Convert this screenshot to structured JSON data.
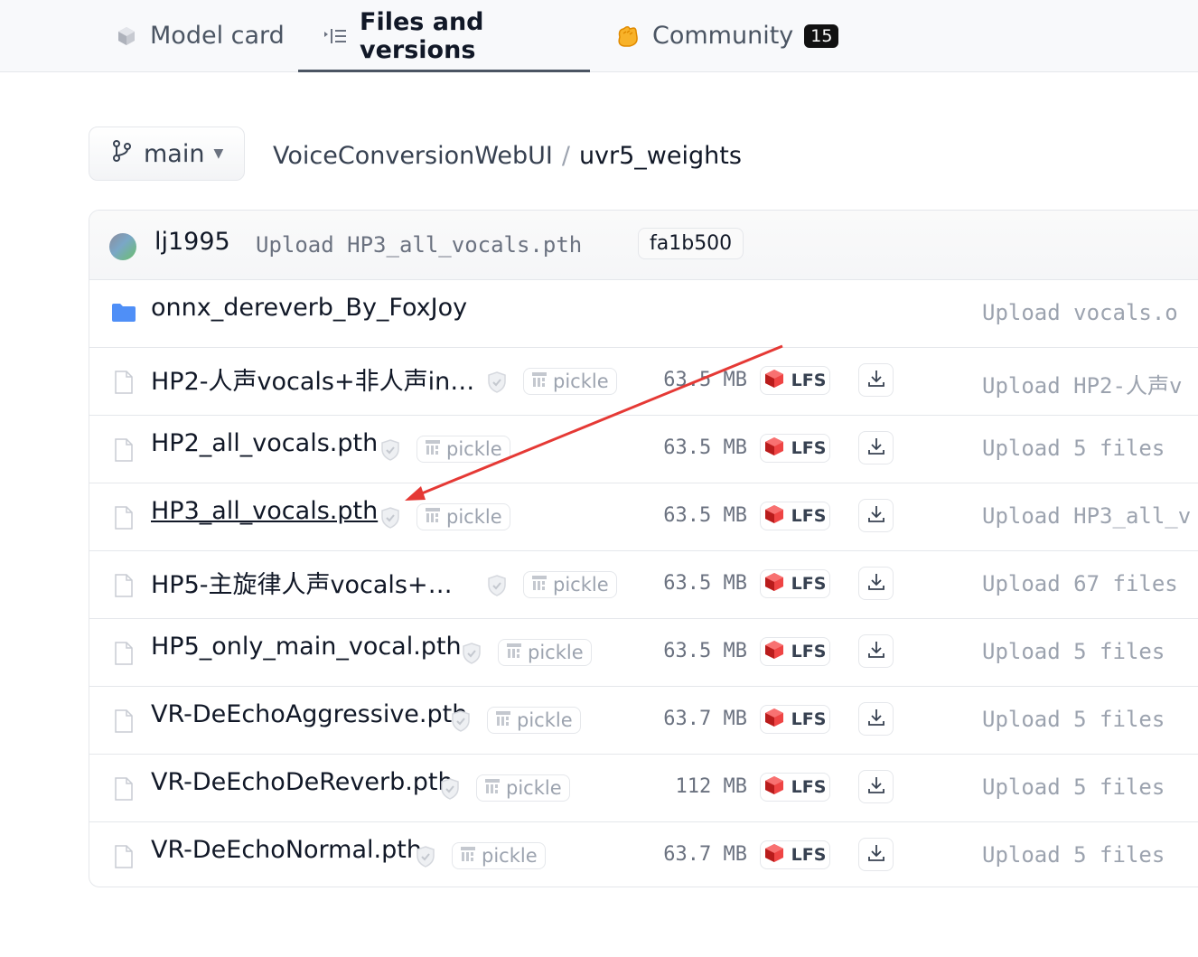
{
  "tabs": [
    {
      "label": "Model card",
      "icon": "cube-icon"
    },
    {
      "label": "Files and versions",
      "icon": "list-icon",
      "active": true
    },
    {
      "label": "Community",
      "icon": "clapping-hands-icon",
      "badge": "15"
    }
  ],
  "branch": {
    "label": "main"
  },
  "breadcrumb": {
    "repo": "VoiceConversionWebUI",
    "separator": "/",
    "folder": "uvr5_weights"
  },
  "commit": {
    "author": "lj1995",
    "message": "Upload HP3_all_vocals.pth",
    "hash": "fa1b500"
  },
  "rows": [
    {
      "name": "onnx_dereverb_By_FoxJoy",
      "type": "folder",
      "commit": "Upload vocals.o"
    },
    {
      "name": "HP2-人声vocals+非人声in…",
      "type": "file",
      "scan": "pickle",
      "size": "63.5 MB",
      "lfs": "LFS",
      "commit": "Upload HP2-人声v"
    },
    {
      "name": "HP2_all_vocals.pth",
      "type": "file",
      "scan": "pickle",
      "size": "63.5 MB",
      "lfs": "LFS",
      "commit": "Upload 5 files"
    },
    {
      "name": "HP3_all_vocals.pth",
      "type": "file",
      "scan": "pickle",
      "size": "63.5 MB",
      "lfs": "LFS",
      "commit": "Upload HP3_all_v"
    },
    {
      "name": "HP5-主旋律人声vocals+…",
      "type": "file",
      "scan": "pickle",
      "size": "63.5 MB",
      "lfs": "LFS",
      "commit": "Upload 67 files"
    },
    {
      "name": "HP5_only_main_vocal.pth",
      "type": "file",
      "scan": "pickle",
      "size": "63.5 MB",
      "lfs": "LFS",
      "commit": "Upload 5 files"
    },
    {
      "name": "VR-DeEchoAggressive.pth",
      "type": "file",
      "scan": "pickle",
      "size": "63.7 MB",
      "lfs": "LFS",
      "commit": "Upload 5 files"
    },
    {
      "name": "VR-DeEchoDeReverb.pth",
      "type": "file",
      "scan": "pickle",
      "size": "112 MB",
      "lfs": "LFS",
      "commit": "Upload 5 files"
    },
    {
      "name": "VR-DeEchoNormal.pth",
      "type": "file",
      "scan": "pickle",
      "size": "63.7 MB",
      "lfs": "LFS",
      "commit": "Upload 5 files"
    }
  ],
  "colors": {
    "accent_arrow": "#e53935",
    "folder": "#4f8ff7",
    "lfs_red": "#ef4444"
  }
}
